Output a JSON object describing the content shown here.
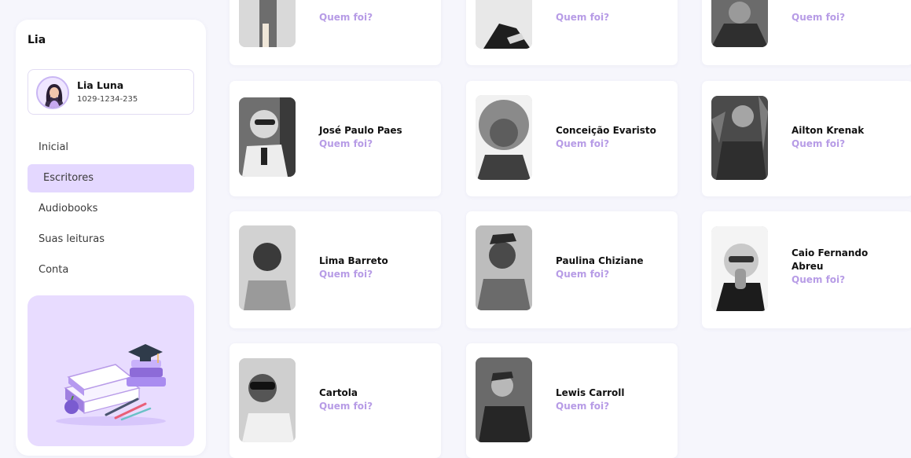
{
  "colors": {
    "accent": "#b79ce6",
    "active_nav_bg": "#e4d8ff",
    "promo_bg": "#e8dcff",
    "page_bg": "#f6f6fc"
  },
  "sidebar": {
    "brand": "Lia",
    "profile": {
      "name": "Lia Luna",
      "id": "1029-1234-235"
    },
    "nav": [
      {
        "label": "Inicial",
        "active": false
      },
      {
        "label": "Escritores",
        "active": true
      },
      {
        "label": "Audiobooks",
        "active": false
      },
      {
        "label": "Suas leituras",
        "active": false
      },
      {
        "label": "Conta",
        "active": false
      }
    ]
  },
  "writers": [
    {
      "name": "",
      "link": "Quem foi?"
    },
    {
      "name": "",
      "link": "Quem foi?"
    },
    {
      "name": "",
      "link": "Quem foi?"
    },
    {
      "name": "José Paulo Paes",
      "link": "Quem foi?"
    },
    {
      "name": "Conceição Evaristo",
      "link": "Quem foi?"
    },
    {
      "name": "Ailton Krenak",
      "link": "Quem foi?"
    },
    {
      "name": "Lima Barreto",
      "link": "Quem foi?"
    },
    {
      "name": "Paulina Chiziane",
      "link": "Quem foi?"
    },
    {
      "name": "Caio Fernando Abreu",
      "link": "Quem foi?"
    },
    {
      "name": "Cartola",
      "link": "Quem foi?"
    },
    {
      "name": "Lewis Carroll",
      "link": "Quem foi?"
    }
  ]
}
